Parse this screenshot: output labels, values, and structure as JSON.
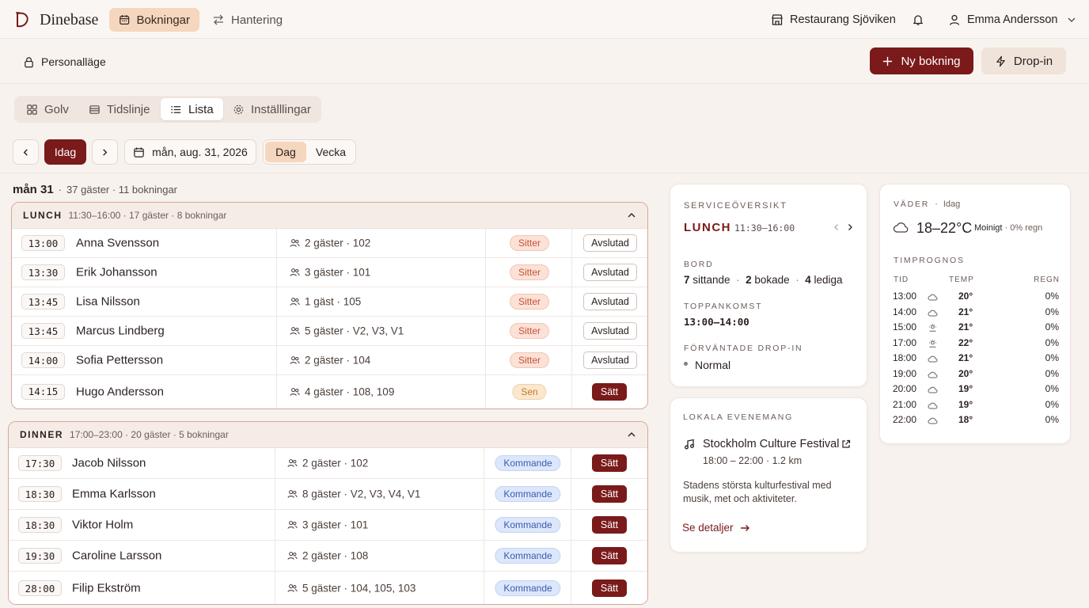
{
  "app": {
    "brand": "Dinebase"
  },
  "nav": {
    "tabs": [
      {
        "label": "Bokningar"
      },
      {
        "label": "Hantering"
      }
    ]
  },
  "topbar": {
    "restaurant": "Restaurang Sjöviken",
    "user": "Emma Andersson"
  },
  "subbar": {
    "staff_mode": "Personalläge",
    "new_booking": "Ny bokning",
    "drop_in": "Drop-in"
  },
  "view_tabs": [
    {
      "label": "Golv"
    },
    {
      "label": "Tidslinje"
    },
    {
      "label": "Lista"
    },
    {
      "label": "Inställlingar"
    }
  ],
  "date_bar": {
    "today": "Idag",
    "date": "mån, aug. 31, 2026",
    "day": "Dag",
    "week": "Vecka"
  },
  "day_summary": {
    "day": "mån 31",
    "sep": "·",
    "stats": "37 gäster · 11 bokningar"
  },
  "groups": [
    {
      "name": "LUNCH",
      "meta": "11:30–16:00 · 17 gäster · 8 bokningar",
      "rows": [
        {
          "time": "13:00",
          "name": "Anna Svensson",
          "guests": "2 gäster · 102",
          "status": "Sitter",
          "action": "Avslutad"
        },
        {
          "time": "13:30",
          "name": "Erik Johansson",
          "guests": "3 gäster · 101",
          "status": "Sitter",
          "action": "Avslutad"
        },
        {
          "time": "13:45",
          "name": "Lisa Nilsson",
          "guests": "1 gäst · 105",
          "status": "Sitter",
          "action": "Avslutad"
        },
        {
          "time": "13:45",
          "name": "Marcus Lindberg",
          "guests": "5 gäster · V2, V3, V1",
          "status": "Sitter",
          "action": "Avslutad"
        },
        {
          "time": "14:00",
          "name": "Sofia Pettersson",
          "guests": "2 gäster · 104",
          "status": "Sitter",
          "action": "Avslutad"
        },
        {
          "time": "14:15",
          "name": "Hugo Andersson",
          "guests": "4 gäster · 108, 109",
          "status": "Sen",
          "action": "Sätt"
        }
      ]
    },
    {
      "name": "DINNER",
      "meta": "17:00–23:00 · 20 gäster · 5 bokningar",
      "rows": [
        {
          "time": "17:30",
          "name": "Jacob Nilsson",
          "guests": "2 gäster · 102",
          "status": "Kommande",
          "action": "Sätt"
        },
        {
          "time": "18:30",
          "name": "Emma Karlsson",
          "guests": "8 gäster · V2, V3, V4, V1",
          "status": "Kommande",
          "action": "Sätt"
        },
        {
          "time": "18:30",
          "name": "Viktor Holm",
          "guests": "3 gäster · 101",
          "status": "Kommande",
          "action": "Sätt"
        },
        {
          "time": "19:30",
          "name": "Caroline Larsson",
          "guests": "2 gäster · 108",
          "status": "Kommande",
          "action": "Sätt"
        },
        {
          "time": "28:00",
          "name": "Filip Ekström",
          "guests": "5 gäster · 104, 105, 103",
          "status": "Kommande",
          "action": "Sätt"
        }
      ]
    }
  ],
  "service": {
    "title": "SERVICEÖVERSIKT",
    "period": "LUNCH",
    "period_time": "11:30–16:00",
    "bord_label": "BORD",
    "seated_n": "7",
    "seated": "sittande",
    "booked_n": "2",
    "booked": "bokade",
    "free_n": "4",
    "free": "lediga",
    "dot": "·",
    "peak_label": "TOPPANKOMST",
    "peak": "13:00–14:00",
    "dropin_label": "FÖRVÄNTADE DROP-IN",
    "dropin": "Normal"
  },
  "events": {
    "title": "LOKALA EVENEMANG",
    "name": "Stockholm Culture Festival",
    "time": "18:00 – 22:00",
    "sep": "·",
    "distance": "1.2 km",
    "desc": "Stadens största kulturfestival med musik, met och aktiviteter.",
    "link": "Se detaljer"
  },
  "weather": {
    "title": "VÄDER",
    "sep": "·",
    "when": "Idag",
    "range": "18–22°C",
    "cond": "Moinigt",
    "rain": "· 0% regn",
    "forecast_label": "TIMPROGNOS",
    "cols": {
      "time": "TID",
      "temp": "TEMP",
      "rain": "REGN"
    },
    "hours": [
      {
        "time": "13:00",
        "icon": "cloud-icon",
        "temp": "20°",
        "rain": "0%"
      },
      {
        "time": "14:00",
        "icon": "cloud-icon",
        "temp": "21°",
        "rain": "0%"
      },
      {
        "time": "15:00",
        "icon": "partly-sunny-icon",
        "temp": "21°",
        "rain": "0%"
      },
      {
        "time": "17:00",
        "icon": "partly-sunny-icon",
        "temp": "22°",
        "rain": "0%"
      },
      {
        "time": "18:00",
        "icon": "cloud-icon",
        "temp": "21°",
        "rain": "0%"
      },
      {
        "time": "19:00",
        "icon": "cloud-icon",
        "temp": "20°",
        "rain": "0%"
      },
      {
        "time": "20:00",
        "icon": "cloud-icon",
        "temp": "19°",
        "rain": "0%"
      },
      {
        "time": "21:00",
        "icon": "cloud-icon",
        "temp": "19°",
        "rain": "0%"
      },
      {
        "time": "22:00",
        "icon": "cloud-icon",
        "temp": "18°",
        "rain": "0%"
      }
    ]
  },
  "colors": {
    "accent": "#7a1a1a",
    "accent_soft": "#f5d6be",
    "background": "#f7f2ee"
  }
}
